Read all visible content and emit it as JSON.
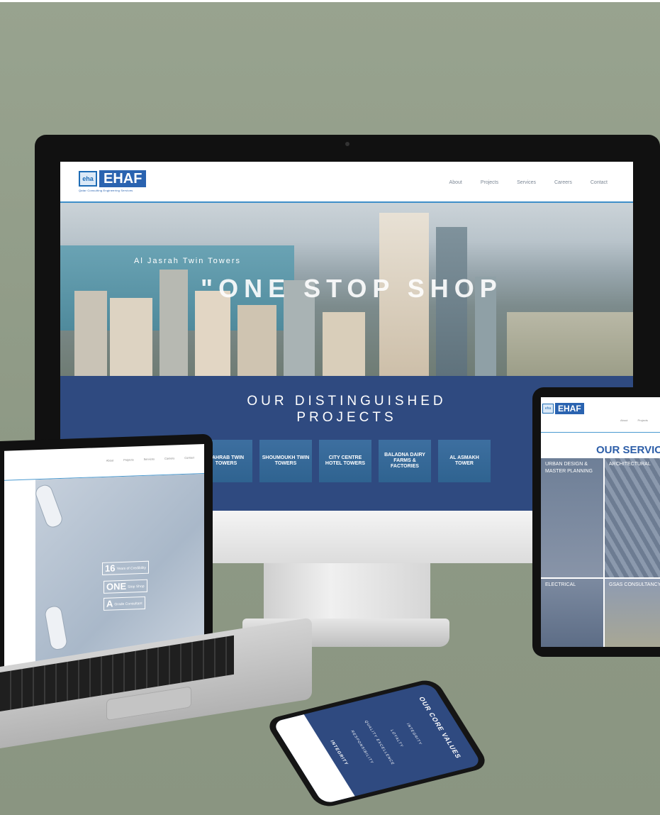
{
  "desktop": {
    "logo_mark": "eha",
    "logo_text": "EHAF",
    "logo_tagline": "Qatar Consulting Engineering Services",
    "nav": [
      "About",
      "Projects",
      "Services",
      "Careers",
      "Contact"
    ],
    "hero_caption": "Al Jasrah Twin Towers",
    "hero_slogan": "\"ONE STOP SHOP",
    "projects_title_line1": "OUR DISTINGUISHED",
    "projects_title_line2": "PROJECTS",
    "project_cards": [
      "KAHRAB TWIN TOWERS",
      "SHOUMOUKH TWIN TOWERS",
      "CITY CENTRE HOTEL TOWERS",
      "BALADNA DAIRY FARMS & FACTORIES",
      "AL ASMAKH TOWER"
    ]
  },
  "laptop": {
    "nav": [
      "About",
      "Projects",
      "Services",
      "Careers",
      "Contact"
    ],
    "badge_16_number": "16",
    "badge_16_text": "Years of Credibility",
    "badge_one_word": "ONE",
    "badge_one_text": "Stop Shop",
    "badge_a_letter": "A",
    "badge_a_text": "Grade Consultant"
  },
  "tablet": {
    "logo_mark": "eha",
    "logo_text": "EHAF",
    "nav": [
      "About",
      "Projects"
    ],
    "title": "OUR SERVIC",
    "services": [
      "URBAN DESIGN & MASTER PLANNING",
      "ARCHITECTURAL",
      "ELECTRICAL",
      "GSAS CONSULTANCY"
    ]
  },
  "phone": {
    "title": "OUR CORE VALUES",
    "values": [
      "INTEGRITY",
      "LOYALTY",
      "QUALITY EXCELLENCE",
      "RESPONSIBILITY"
    ],
    "highlight": "INTEGRITY"
  },
  "colors": {
    "brand_blue": "#2a63b0",
    "navy_section": "#2f4a80",
    "accent_line": "#3f8fc9",
    "backdrop": "#8f9b86"
  }
}
